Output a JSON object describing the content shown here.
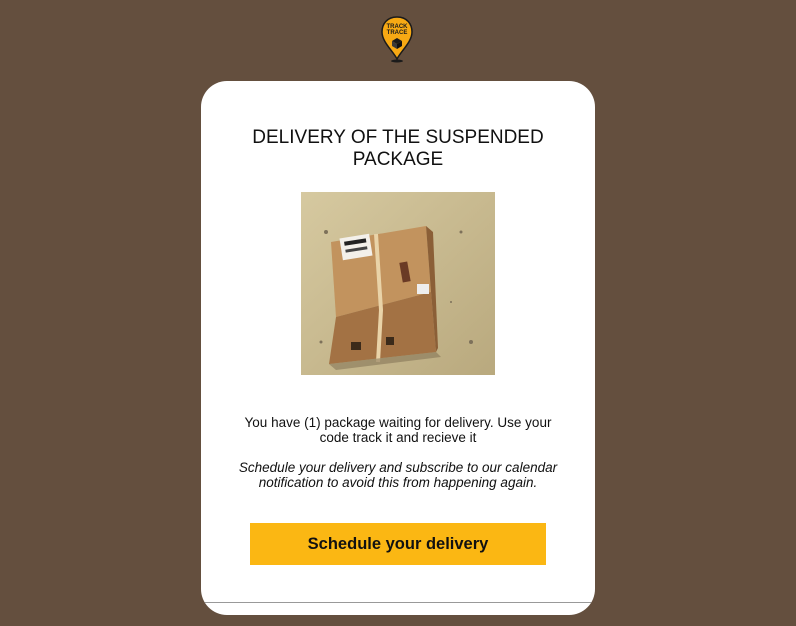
{
  "header": {
    "logo_icon": "track-trace-pin-icon",
    "logo_text_line1": "TRACK",
    "logo_text_line2": "TRACE"
  },
  "card": {
    "title": "DELIVERY OF THE SUSPENDED PACKAGE",
    "image_icon": "package-box-photo",
    "message": "You have (1) package waiting for delivery. Use your code track it and recieve it",
    "note": "Schedule your delivery and subscribe to our calendar notification to avoid this from happening again.",
    "cta_label": "Schedule your delivery"
  },
  "colors": {
    "background": "#644f3e",
    "card": "#ffffff",
    "cta": "#fbb713",
    "logo": "#f7a914"
  }
}
